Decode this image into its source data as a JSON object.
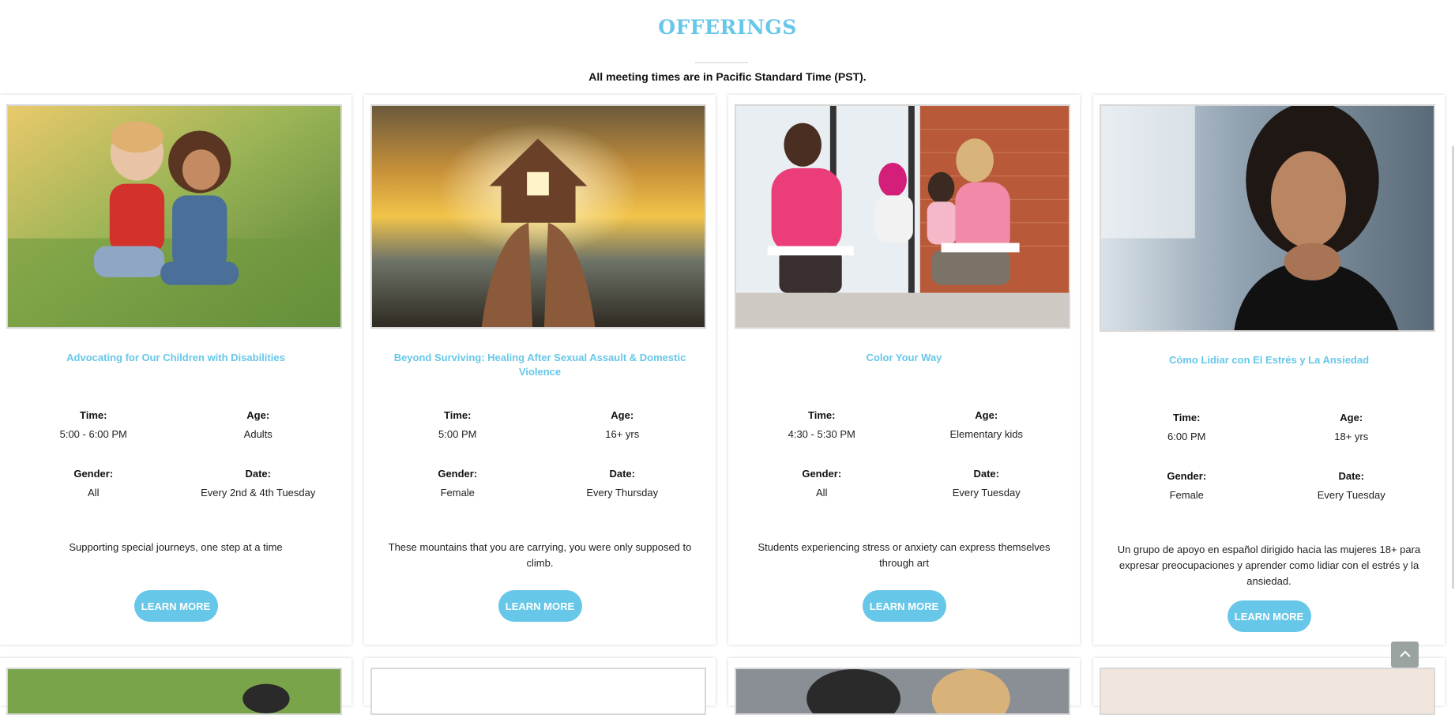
{
  "section": {
    "title": "OFFERINGS",
    "subtitle": "All meeting times are in Pacific Standard Time (PST)."
  },
  "labels": {
    "time": "Time:",
    "age": "Age:",
    "gender": "Gender:",
    "date": "Date:"
  },
  "cards": [
    {
      "title": "Advocating for Our Children with Disabilities",
      "time": "5:00 - 6:00 PM",
      "age": "Adults",
      "gender": "All",
      "date": "Every 2nd & 4th Tuesday",
      "description": "Supporting special journeys, one step at a time",
      "button": "LEARN MORE",
      "image": "two-toddlers-on-grass"
    },
    {
      "title": "Beyond Surviving: Healing After Sexual Assault & Domestic Violence",
      "time": "5:00 PM",
      "age": "16+ yrs",
      "gender": "Female",
      "date": "Every Thursday",
      "description": "These mountains that you are carrying, you were only supposed to climb.",
      "button": "LEARN MORE",
      "image": "hands-holding-house-at-sunset"
    },
    {
      "title": "Color Your Way",
      "time": "4:30 - 5:30 PM",
      "age": "Elementary kids",
      "gender": "All",
      "date": "Every Tuesday",
      "description": "Students experiencing stress or anxiety can express themselves through art",
      "button": "LEARN MORE",
      "image": "women-support-group"
    },
    {
      "title": "Cómo Lidiar con El Estrés y La Ansiedad",
      "time": "6:00 PM",
      "age": "18+ yrs",
      "gender": "Female",
      "date": "Every Tuesday",
      "description": "Un grupo de apoyo en español dirigido hacia las mujeres 18+ para expresar preocupaciones y aprender como lidiar con el estrés y la ansiedad.",
      "button": "LEARN MORE",
      "image": "thoughtful-woman"
    }
  ],
  "colors": {
    "accent": "#67c7e9",
    "text": "#222222"
  },
  "icons": {
    "scroll_top": "chevron-up-icon"
  }
}
